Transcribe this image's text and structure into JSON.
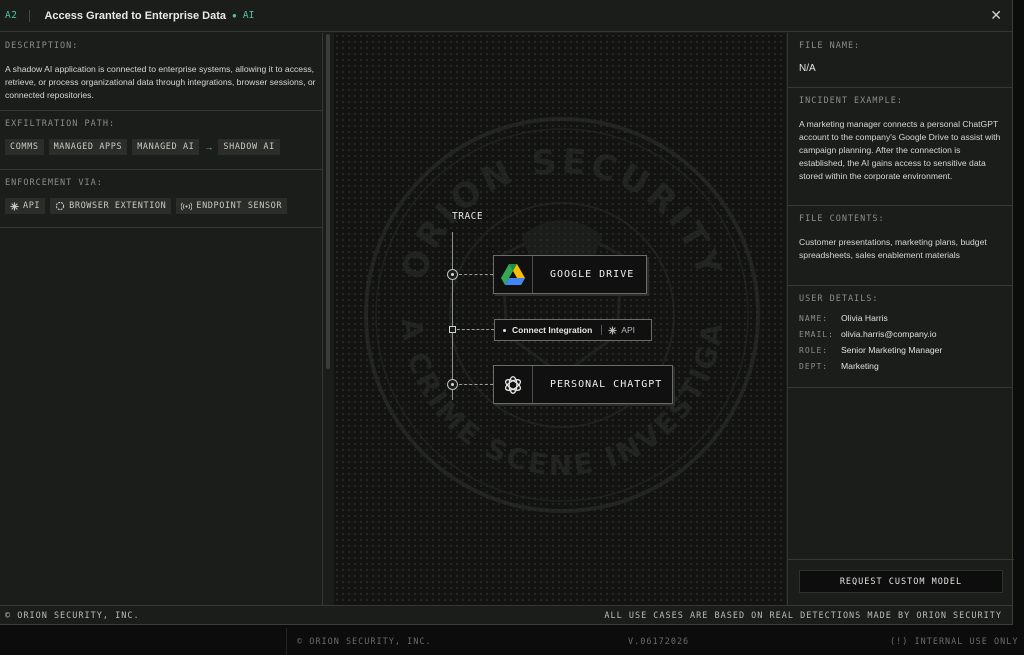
{
  "titlebar": {
    "code": "A2",
    "title": "Access Granted to Enterprise Data",
    "tag": "AI",
    "close_icon": "close-icon"
  },
  "left": {
    "description_label": "DESCRIPTION:",
    "description": "A shadow AI application is connected to enterprise systems, allowing it to access, retrieve, or process organizational data through integrations, browser sessions, or connected repositories.",
    "exfil_label": "EXFILTRATION PATH:",
    "exfil_path": [
      "COMMS",
      "MANAGED APPS",
      "MANAGED AI",
      "SHADOW AI"
    ],
    "enforcement_label": "ENFORCEMENT VIA:",
    "enforcement": [
      {
        "icon": "api-icon",
        "label": "API"
      },
      {
        "icon": "browser-extension-icon",
        "label": "BROWSER EXTENTION"
      },
      {
        "icon": "endpoint-sensor-icon",
        "label": "ENDPOINT SENSOR"
      }
    ]
  },
  "center": {
    "trace_label": "TRACE",
    "nodes": {
      "google_drive": "GOOGLE DRIVE",
      "connect_integration": "Connect Integration",
      "connect_api": "API",
      "personal_chatgpt": "PERSONAL CHATGPT"
    },
    "watermark": {
      "top": "ORION SECURITY",
      "bottom": "DATA CRIME SCENE INVESTIGATOR"
    }
  },
  "right": {
    "file_name_label": "FILE NAME:",
    "file_name": "N/A",
    "incident_label": "INCIDENT EXAMPLE:",
    "incident": "A marketing manager connects a personal ChatGPT account to the company's Google Drive to assist with campaign planning. After the connection is established, the AI gains access to sensitive data stored within the corporate environment.",
    "contents_label": "FILE CONTENTS:",
    "contents": "Customer presentations, marketing plans, budget spreadsheets, sales enablement materials",
    "user_label": "USER DETAILS:",
    "user": {
      "name_k": "NAME:",
      "name": "Olivia Harris",
      "email_k": "EMAIL:",
      "email": "olivia.harris@company.io",
      "role_k": "ROLE:",
      "role": "Senior Marketing Manager",
      "dept_k": "DEPT:",
      "dept": "Marketing"
    },
    "request_button": "REQUEST CUSTOM MODEL"
  },
  "footer": {
    "left": "© ORION SECURITY, INC.",
    "right": "ALL USE CASES ARE BASED ON REAL DETECTIONS MADE BY ORION SECURITY"
  },
  "background_bar": {
    "company": "© ORION SECURITY, INC.",
    "version": "V.06172026",
    "notice": "(!) INTERNAL USE ONLY"
  },
  "colors": {
    "accent": "#4fc3a8",
    "panel": "#1b1d1a",
    "canvas": "#131412"
  }
}
